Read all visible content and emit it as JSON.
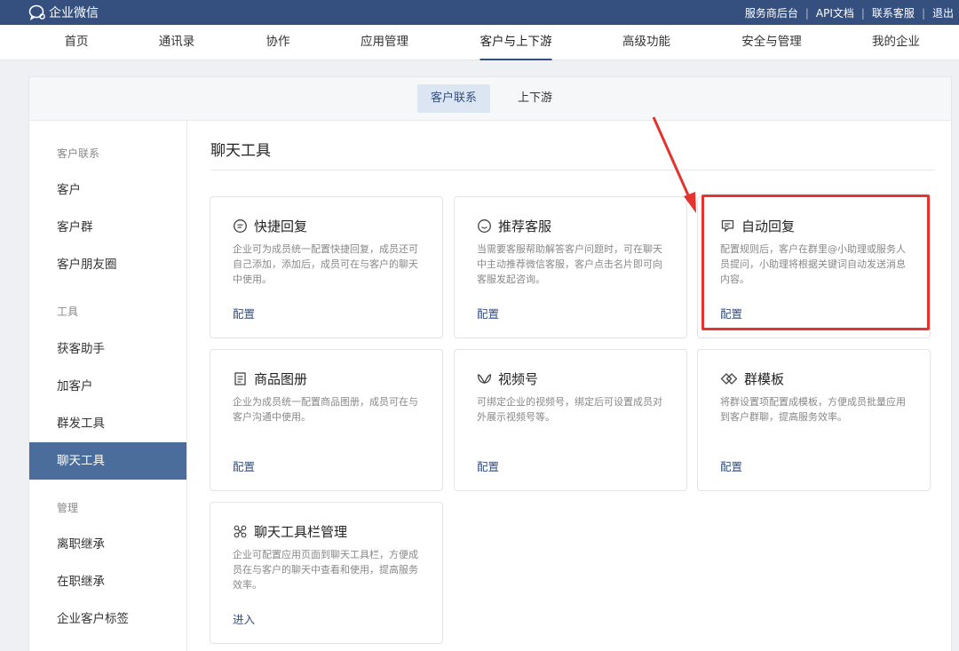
{
  "app": {
    "name": "企业微信"
  },
  "top_links": [
    "服务商后台",
    "API文档",
    "联系客服",
    "退出"
  ],
  "nav": {
    "items": [
      "首页",
      "通讯录",
      "协作",
      "应用管理",
      "客户与上下游",
      "高级功能",
      "安全与管理",
      "我的企业"
    ],
    "active": "客户与上下游"
  },
  "subtabs": [
    "客户联系",
    "上下游"
  ],
  "sidebar": {
    "groups": [
      {
        "label": "客户联系",
        "items": [
          "客户",
          "客户群",
          "客户朋友圈"
        ]
      },
      {
        "label": "工具",
        "items": [
          "获客助手",
          "加客户",
          "群发工具",
          "聊天工具"
        ]
      },
      {
        "label": "管理",
        "items": [
          "离职继承",
          "在职继承",
          "企业客户标签"
        ]
      }
    ],
    "active": "聊天工具"
  },
  "content": {
    "title": "聊天工具",
    "cards": [
      {
        "icon": "quick-reply-icon",
        "title": "快捷回复",
        "desc": "企业可为成员统一配置快捷回复，成员还可自己添加，添加后，成员可在与客户的聊天中使用。",
        "action": "配置"
      },
      {
        "icon": "recommend-service-icon",
        "title": "推荐客服",
        "desc": "当需要客服帮助解答客户问题时，可在聊天中主动推荐微信客服，客户点击名片即可向客服发起咨询。",
        "action": "配置"
      },
      {
        "icon": "auto-reply-icon",
        "title": "自动回复",
        "desc": "配置规则后，客户在群里@小助理或服务人员提问，小助理将根据关键词自动发送消息内容。",
        "action": "配置"
      },
      {
        "icon": "product-album-icon",
        "title": "商品图册",
        "desc": "企业为成员统一配置商品图册，成员可在与客户沟通中使用。",
        "action": "配置"
      },
      {
        "icon": "channels-icon",
        "title": "视频号",
        "desc": "可绑定企业的视频号，绑定后可设置成员对外展示视频号等。",
        "action": "配置"
      },
      {
        "icon": "group-template-icon",
        "title": "群模板",
        "desc": "将群设置项配置成模板，方便成员批量应用到客户群聊，提高服务效率。",
        "action": "配置"
      },
      {
        "icon": "toolbar-manage-icon",
        "title": "聊天工具栏管理",
        "desc": "企业可配置应用页面到聊天工具栏，方便成员在与客户的聊天中查看和使用，提高服务效率。",
        "action": "进入"
      }
    ]
  },
  "colors": {
    "brand": "#35507e",
    "active_side": "#4a6d9b",
    "annotation": "#e3342f"
  }
}
